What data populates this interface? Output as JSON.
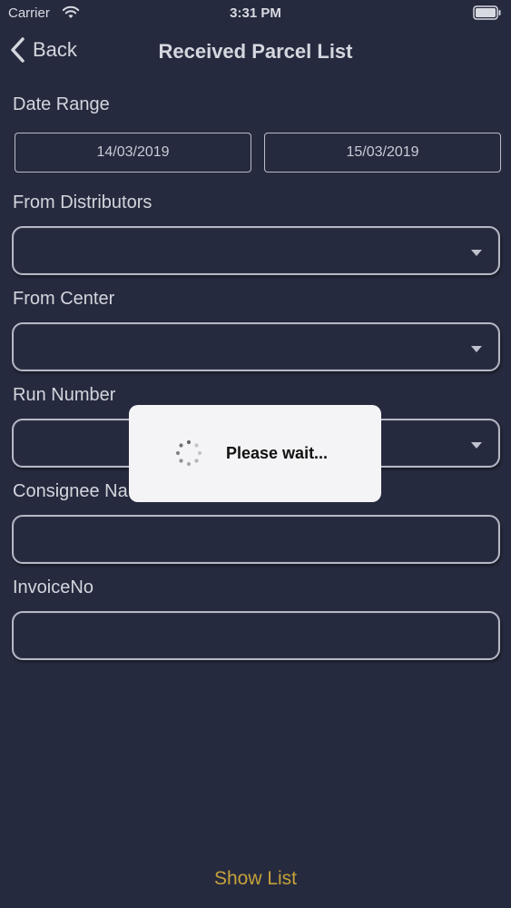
{
  "status_bar": {
    "carrier": "Carrier",
    "time": "3:31 PM",
    "wifi_icon": "wifi-icon",
    "battery_icon": "battery-icon"
  },
  "nav": {
    "back_label": "Back",
    "title": "Received Parcel List"
  },
  "form": {
    "date_range_label": "Date Range",
    "date_from": "14/03/2019",
    "date_to": "15/03/2019",
    "from_distributors_label": "From Distributors",
    "from_distributors_value": "",
    "from_center_label": "From Center",
    "from_center_value": "",
    "run_number_label": "Run Number",
    "run_number_value": "",
    "consignee_name_label": "Consignee Na",
    "consignee_name_value": "",
    "invoice_no_label": "InvoiceNo",
    "invoice_no_value": ""
  },
  "dialog": {
    "message": "Please wait..."
  },
  "footer": {
    "show_list_label": "Show List"
  },
  "colors": {
    "background": "#262a3e",
    "accent": "#c5a23b",
    "dialog_bg": "#f4f4f6"
  }
}
